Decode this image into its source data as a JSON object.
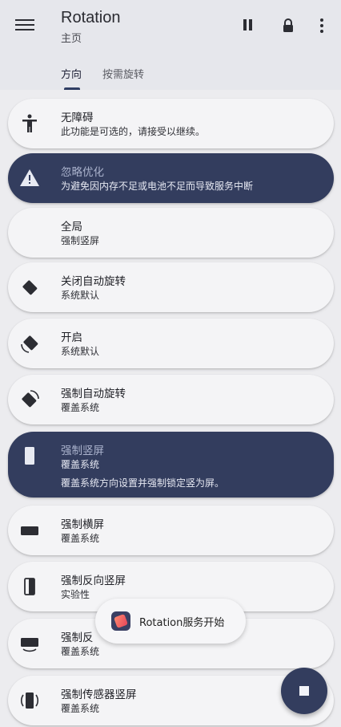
{
  "header": {
    "title": "Rotation",
    "subtitle": "主页"
  },
  "tabs": [
    {
      "label": "方向"
    },
    {
      "label": "按需旋转"
    }
  ],
  "cards": [
    {
      "title": "无障碍",
      "subtitle": "此功能是可选的，请接受以继续。",
      "icon": "accessibility-icon"
    },
    {
      "title": "忽略优化",
      "subtitle": "为避免因内存不足或电池不足而导致服务中断",
      "icon": "warning-icon",
      "selected": true
    },
    {
      "title": "全局",
      "subtitle": "强制竖屏"
    },
    {
      "title": "关闭自动旋转",
      "subtitle": "系统默认",
      "icon": "rotation-off-icon"
    },
    {
      "title": "开启",
      "subtitle": "系统默认",
      "icon": "auto-rotate-icon"
    },
    {
      "title": "强制自动旋转",
      "subtitle": "覆盖系统",
      "icon": "force-auto-rotate-icon"
    },
    {
      "title": "强制竖屏",
      "subtitle": "覆盖系统",
      "detail": "覆盖系统方向设置并强制锁定竖为屏。",
      "icon": "portrait-icon",
      "selected": true
    },
    {
      "title": "强制横屏",
      "subtitle": "覆盖系统",
      "icon": "landscape-icon"
    },
    {
      "title": "强制反向竖屏",
      "subtitle": "实验性",
      "icon": "reverse-portrait-icon"
    },
    {
      "title": "强制反",
      "subtitle": "覆盖系统",
      "icon": "reverse-landscape-icon"
    },
    {
      "title": "强制传感器竖屏",
      "subtitle": "覆盖系统",
      "icon": "sensor-portrait-icon"
    }
  ],
  "toast": {
    "text": "Rotation服务开始"
  },
  "colors": {
    "accent": "#333d5e",
    "background": "#ececef"
  }
}
